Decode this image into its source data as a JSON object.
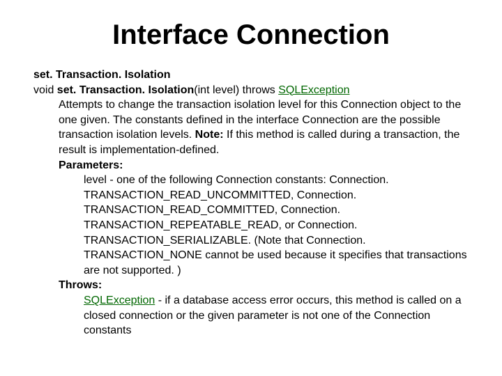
{
  "title": "Interface Connection",
  "method_name_heading": "set. Transaction. Isolation",
  "signature": {
    "prefix": "void ",
    "name": "set. Transaction. Isolation",
    "args": "(int level) throws ",
    "throws_link": "SQLException"
  },
  "description": {
    "body": "Attempts to change the transaction isolation level for this Connection object to the one given. The constants defined in the interface Connection are the possible transaction isolation levels. ",
    "note_label": "Note:",
    "note_body": " If this method is called during a transaction, the result is implementation-defined."
  },
  "parameters": {
    "label": "Parameters:",
    "body": "level - one of the following Connection constants: Connection. TRANSACTION_READ_UNCOMMITTED, Connection. TRANSACTION_READ_COMMITTED, Connection. TRANSACTION_REPEATABLE_READ, or Connection. TRANSACTION_SERIALIZABLE. (Note that Connection. TRANSACTION_NONE cannot be used because it specifies that transactions are not supported. )"
  },
  "throws": {
    "label": "Throws:",
    "link": "SQLException",
    "body": " - if a database access error occurs, this method is called on a closed connection or the given parameter is not one of the Connection constants"
  }
}
